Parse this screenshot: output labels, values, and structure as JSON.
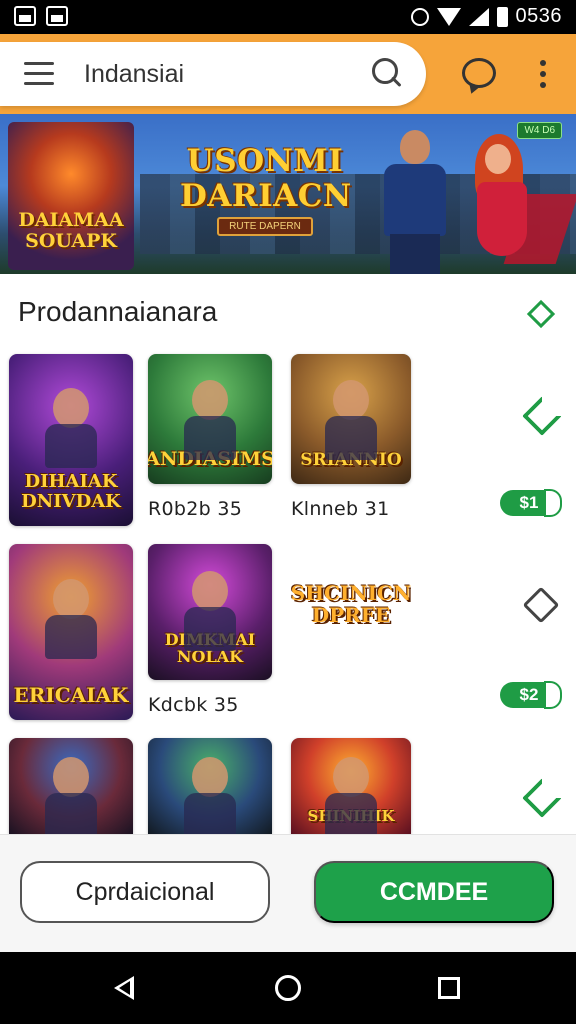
{
  "status_bar": {
    "time": "0536"
  },
  "app_bar": {
    "search_text": "Indansiai"
  },
  "banner": {
    "thumb_title": "DAIAMAA SOUAPK",
    "title_line1": "USONMI",
    "title_line2": "DARIACN",
    "subtitle": "RUTE DAPERN",
    "badge": "W4 D6"
  },
  "section": {
    "title": "Prodannaianara",
    "rows": [
      {
        "cards": [
          {
            "label": "DIHAIAK DNIVDAK",
            "caption": ""
          },
          {
            "label": "ANDIASIMS",
            "caption": "R0b2b  35"
          },
          {
            "label": "SRIANNIO",
            "caption": "Klnneb  31"
          }
        ],
        "price": "$1"
      },
      {
        "cards": [
          {
            "label": "ERICAIAK",
            "caption": ""
          },
          {
            "label": "DIMKMAI NOLAK",
            "caption": "Kdcbk  35"
          },
          {
            "label": "SHCINICN DPRFE",
            "caption": ""
          }
        ],
        "price": "$2"
      },
      {
        "cards": [
          {
            "label": "",
            "caption": ""
          },
          {
            "label": "",
            "caption": ""
          },
          {
            "label": "SHINIHIK",
            "caption": ""
          }
        ]
      }
    ]
  },
  "actions": {
    "secondary_label": "Cprdaicional",
    "primary_label": "CCMDEE"
  },
  "colors": {
    "accent": "#f6a43a",
    "green": "#1ea14a"
  }
}
